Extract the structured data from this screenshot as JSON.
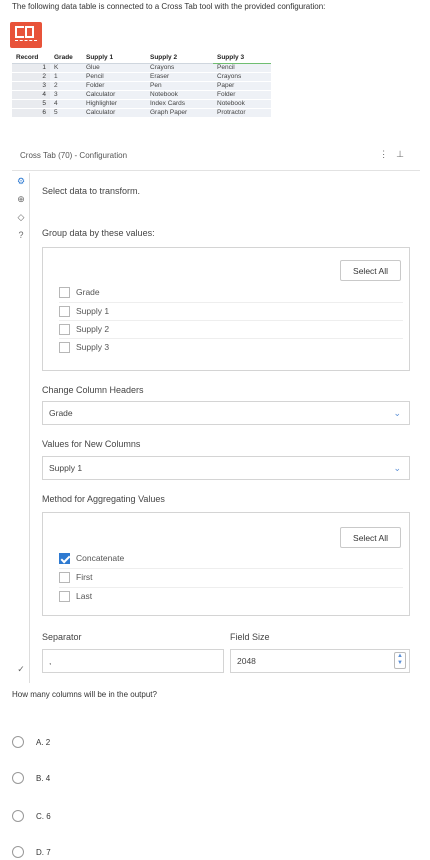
{
  "intro": "The following data table is connected to a Cross Tab tool with the provided configuration:",
  "icons": {
    "tool": "cross-tab-tool-icon"
  },
  "table": {
    "headers": [
      "Record",
      "Grade",
      "Supply 1",
      "Supply 2",
      "Supply 3"
    ],
    "rows": [
      [
        "1",
        "K",
        "Glue",
        "Crayons",
        "Pencil"
      ],
      [
        "2",
        "1",
        "Pencil",
        "Eraser",
        "Crayons"
      ],
      [
        "3",
        "2",
        "Folder",
        "Pen",
        "Paper"
      ],
      [
        "4",
        "3",
        "Calculator",
        "Notebook",
        "Folder"
      ],
      [
        "5",
        "4",
        "Highlighter",
        "Index Cards",
        "Notebook"
      ],
      [
        "6",
        "5",
        "Calculator",
        "Graph Paper",
        "Protractor"
      ]
    ]
  },
  "config": {
    "title": "Cross Tab (70) - Configuration",
    "header_icons": [
      "⋮",
      "⊥"
    ],
    "select_data": "Select data to transform.",
    "group_label": "Group data by these values:",
    "select_all": "Select All",
    "group_fields": [
      {
        "label": "Grade",
        "checked": false
      },
      {
        "label": "Supply 1",
        "checked": false
      },
      {
        "label": "Supply 2",
        "checked": false
      },
      {
        "label": "Supply 3",
        "checked": false
      }
    ],
    "change_headers_label": "Change Column Headers",
    "change_headers_value": "Grade",
    "values_label": "Values for New Columns",
    "values_value": "Supply 1",
    "method_label": "Method for Aggregating Values",
    "methods": [
      {
        "label": "Concatenate",
        "checked": true
      },
      {
        "label": "First",
        "checked": false
      },
      {
        "label": "Last",
        "checked": false
      }
    ],
    "separator_label": "Separator",
    "separator_value": ",",
    "field_size_label": "Field Size",
    "field_size_value": "2048"
  },
  "question": "How many columns will be in the output?",
  "options": [
    "A. 2",
    "B. 4",
    "C. 6",
    "D. 7"
  ]
}
